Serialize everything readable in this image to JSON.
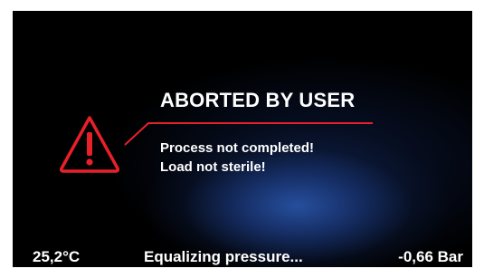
{
  "colors": {
    "background": "#000000",
    "glow": "#2852a5",
    "accent": "#e8202a",
    "text": "#ffffff"
  },
  "alert": {
    "icon": "warning-triangle-icon",
    "title": "ABORTED BY USER",
    "messages": [
      "Process not completed!",
      "Load not sterile!"
    ]
  },
  "status_bar": {
    "temperature": "25,2°C",
    "status": "Equalizing pressure...",
    "pressure": "-0,66 Bar"
  }
}
